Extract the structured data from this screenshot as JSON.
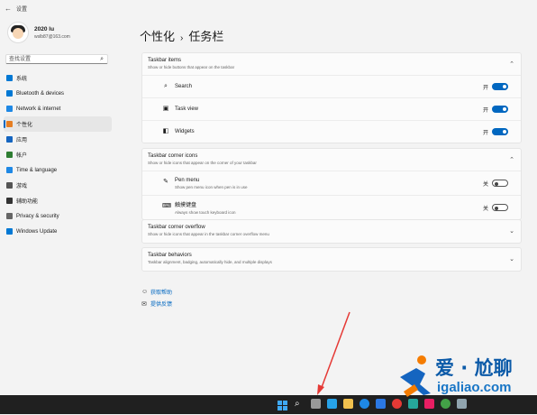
{
  "titlebar": {
    "back_glyph": "←",
    "title": "设置"
  },
  "profile": {
    "name": "2020 lu",
    "email": "wslb87@163.com"
  },
  "search": {
    "placeholder": "查找设置",
    "icon": "search-icon"
  },
  "nav": [
    {
      "label": "系统",
      "color": "#0078d4",
      "icon": "system-icon"
    },
    {
      "label": "Bluetooth & devices",
      "color": "#0078d4",
      "icon": "bluetooth-icon"
    },
    {
      "label": "Network & internet",
      "color": "#1e88e5",
      "icon": "network-icon"
    },
    {
      "label": "个性化",
      "color": "#e67e22",
      "icon": "personalization-icon",
      "active": true
    },
    {
      "label": "应用",
      "color": "#1565c0",
      "icon": "apps-icon"
    },
    {
      "label": "帐户",
      "color": "#2e7d32",
      "icon": "accounts-icon"
    },
    {
      "label": "Time & language",
      "color": "#1e88e5",
      "icon": "time-language-icon"
    },
    {
      "label": "游戏",
      "color": "#555555",
      "icon": "gaming-icon"
    },
    {
      "label": "辅助功能",
      "color": "#333333",
      "icon": "accessibility-icon"
    },
    {
      "label": "Privacy & security",
      "color": "#666666",
      "icon": "privacy-icon"
    },
    {
      "label": "Windows Update",
      "color": "#0078d4",
      "icon": "update-icon"
    }
  ],
  "heading": {
    "parent": "个性化",
    "separator": "›",
    "current": "任务栏"
  },
  "taskbar_items": {
    "title": "Taskbar items",
    "subtitle": "Show or hide buttons that appear on the taskbar",
    "rows": [
      {
        "label": "Search",
        "state": "开",
        "on": true,
        "icon": "search-icon",
        "glyph": "⌕"
      },
      {
        "label": "Task view",
        "state": "开",
        "on": true,
        "icon": "task-view-icon",
        "glyph": "▣"
      },
      {
        "label": "Widgets",
        "state": "开",
        "on": true,
        "icon": "widgets-icon",
        "glyph": "◧"
      }
    ]
  },
  "corner_icons": {
    "title": "Taskbar corner icons",
    "subtitle": "Show or hide icons that appear on the corner of your taskbar",
    "rows": [
      {
        "label": "Pen menu",
        "sub": "Show pen menu icon when pen is in use",
        "state": "关",
        "on": false,
        "icon": "pen-icon",
        "glyph": "✎"
      },
      {
        "label": "触摸键盘",
        "sub": "Always show touch keyboard icon",
        "state": "关",
        "on": false,
        "icon": "keyboard-icon",
        "glyph": "⌨"
      }
    ]
  },
  "corner_overflow": {
    "title": "Taskbar corner overflow",
    "subtitle": "Show or hide icons that appear in the taskbar corner overflow menu"
  },
  "behaviors": {
    "title": "Taskbar behaviors",
    "subtitle": "Taskbar alignment, badging, automatically hide, and multiple displays"
  },
  "links": {
    "help": "获取帮助",
    "feedback": "提供反馈"
  },
  "watermark": {
    "line1": "爱 · 尬聊",
    "line2": "igaliao.com"
  },
  "chevrons": {
    "up": "⌃",
    "down": "⌄"
  },
  "colors": {
    "accent": "#0067c0",
    "taskbar": "#202020",
    "arrow": "#e53935"
  }
}
